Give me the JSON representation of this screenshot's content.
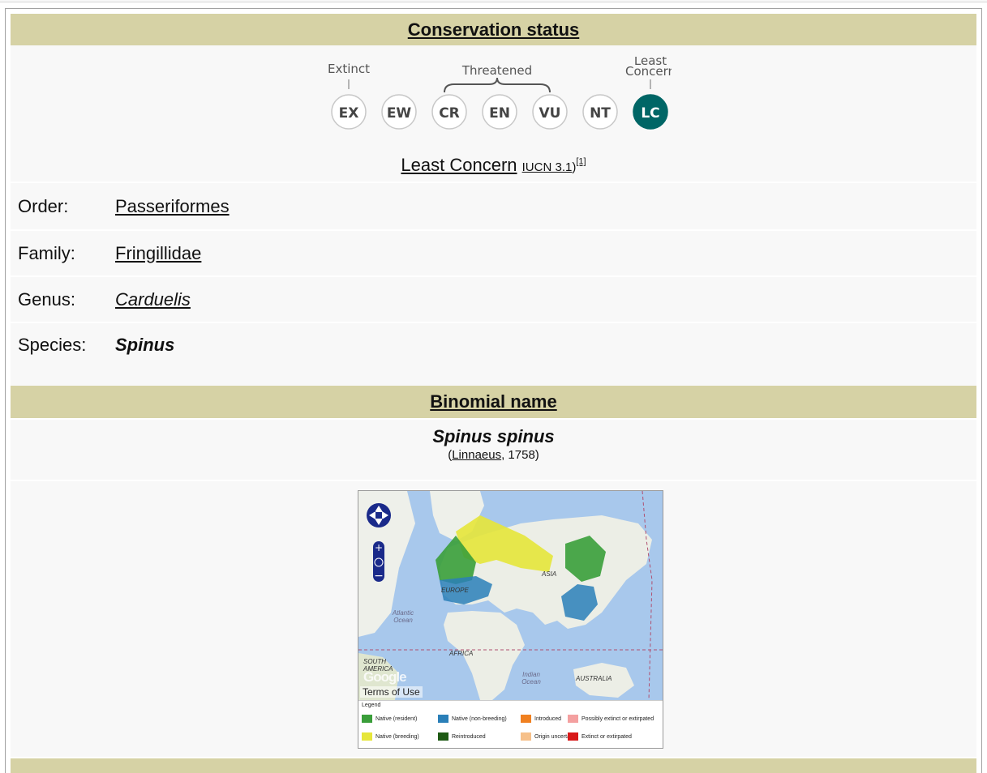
{
  "conservation": {
    "header": "Conservation status",
    "labels": {
      "extinct": "Extinct",
      "threatened": "Threatened",
      "least": "Least",
      "concern": "Concern"
    },
    "codes": [
      "EX",
      "EW",
      "CR",
      "EN",
      "VU",
      "NT",
      "LC"
    ],
    "selected": "LC",
    "selected_color": "#006666",
    "status_link": "Least Concern",
    "version_link": "IUCN 3.1",
    "ref": "[1]"
  },
  "taxonomy": [
    {
      "rank": "Order:",
      "value": "Passeriformes",
      "style": "link"
    },
    {
      "rank": "Family:",
      "value": "Fringillidae",
      "style": "link"
    },
    {
      "rank": "Genus:",
      "value": "Carduelis",
      "style": "italic-link"
    },
    {
      "rank": "Species:",
      "value": "Spinus",
      "style": "bold-italic"
    }
  ],
  "binomial": {
    "header": "Binomial name",
    "name": "Spinus spinus",
    "paren_open": "(",
    "author_link": "Linnaeus",
    "year": ", 1758)"
  },
  "map": {
    "labels": {
      "asia": "ASIA",
      "europe": "EUROPE",
      "africa": "AFRICA",
      "atlantic": "Atlantic Ocean",
      "indian": "Indian Ocean",
      "south_america": "SOUTH AMERICA",
      "australia": "AUSTRALIA",
      "google": "Google",
      "terms": "Terms of Use"
    },
    "legend_title": "Legend",
    "legend": [
      {
        "label": "Native (resident)",
        "color": "#3a9e3a"
      },
      {
        "label": "Native (non-breeding)",
        "color": "#2a7fb8"
      },
      {
        "label": "Introduced",
        "color": "#f08020"
      },
      {
        "label": "Possibly extinct or extirpated",
        "color": "#f4a0a0"
      },
      {
        "label": "Native (breeding)",
        "color": "#e6e63a"
      },
      {
        "label": "Reintroduced",
        "color": "#1e5a14"
      },
      {
        "label": "Origin uncertain",
        "color": "#f6c08a"
      },
      {
        "label": "Extinct or extirpated",
        "color": "#d81818"
      }
    ]
  },
  "colors": {
    "header_bg": "#d6d2a5",
    "cell_bg": "#f8f8f8"
  }
}
